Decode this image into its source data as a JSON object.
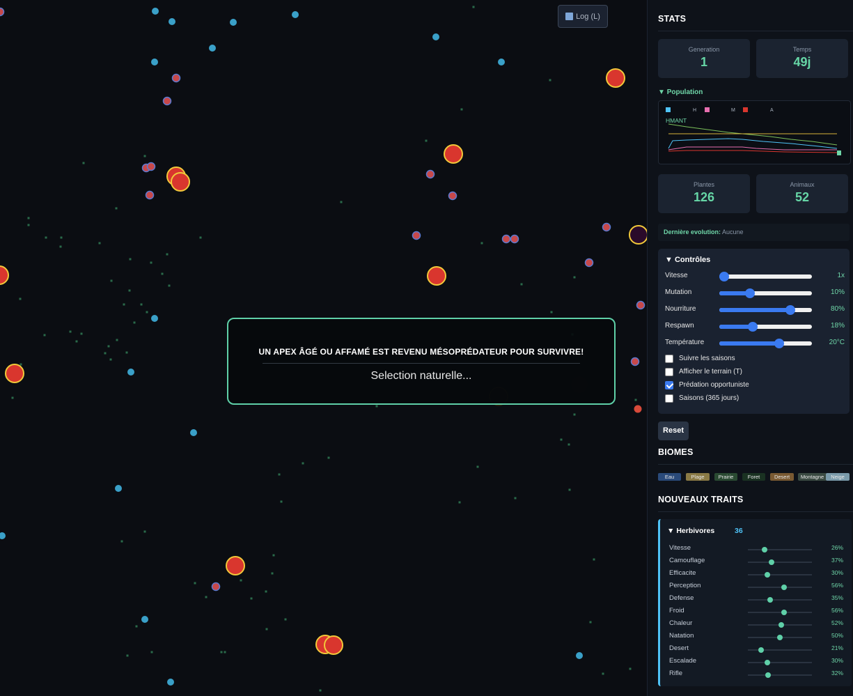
{
  "log_button": {
    "label": "Log (L)",
    "icon": "bar-chart-icon"
  },
  "notification": {
    "message": "UN APEX ÂGÉ OU AFFAMÉ EST REVENU MÉSOPRÉDATEUR POUR SURVIVRE!",
    "subtitle": "Selection naturelle..."
  },
  "stats": {
    "title": "STATS",
    "generation_label": "Generation",
    "generation": "1",
    "time_label": "Temps",
    "time": "49j",
    "population_title": "Population",
    "legend": [
      "H",
      "M",
      "A"
    ],
    "chart_letters": "HMANT",
    "plants_label": "Plantes",
    "plants": "126",
    "animals_label": "Animaux",
    "animals": "52",
    "evolution_label": "Dernière evolution:",
    "evolution_value": "Aucune"
  },
  "colors": {
    "herbivore": "#4fc3f7",
    "mesopredator": "#e86fb0",
    "apex": "#d9362e",
    "accent": "#66d6a6",
    "slider": "#3a7af0"
  },
  "controls": {
    "title": "Contrôles",
    "sliders": [
      {
        "name": "Vitesse",
        "value": "1x",
        "fraction": 0.05
      },
      {
        "name": "Mutation",
        "value": "10%",
        "fraction": 0.33
      },
      {
        "name": "Nourriture",
        "value": "80%",
        "fraction": 0.77
      },
      {
        "name": "Respawn",
        "value": "18%",
        "fraction": 0.36
      },
      {
        "name": "Température",
        "value": "20°C",
        "fraction": 0.65
      }
    ],
    "checkboxes": [
      {
        "label": "Suivre les saisons",
        "checked": false
      },
      {
        "label": "Afficher le terrain (T)",
        "checked": false
      },
      {
        "label": "Prédation opportuniste",
        "checked": true
      },
      {
        "label": "Saisons (365 jours)",
        "checked": false
      }
    ],
    "reset_label": "Reset"
  },
  "biomes": {
    "title": "BIOMES",
    "items": [
      {
        "name": "Eau",
        "color": "#2a4a7a"
      },
      {
        "name": "Plage",
        "color": "#8a7a45"
      },
      {
        "name": "Prairie",
        "color": "#2a4a32"
      },
      {
        "name": "Foret",
        "color": "#1a3222"
      },
      {
        "name": "Desert",
        "color": "#7a5a32"
      },
      {
        "name": "Montagne",
        "color": "#3a4a42"
      },
      {
        "name": "Neige",
        "color": "#7a9aaa"
      }
    ]
  },
  "traits": {
    "title": "NOUVEAUX TRAITS",
    "group_name": "Herbivores",
    "group_count": "36",
    "items": [
      {
        "name": "Vitesse",
        "value": "26%",
        "fraction": 0.26
      },
      {
        "name": "Camouflage",
        "value": "37%",
        "fraction": 0.37
      },
      {
        "name": "Efficacite",
        "value": "30%",
        "fraction": 0.3
      },
      {
        "name": "Perception",
        "value": "56%",
        "fraction": 0.56
      },
      {
        "name": "Defense",
        "value": "35%",
        "fraction": 0.35
      },
      {
        "name": "Froid",
        "value": "56%",
        "fraction": 0.56
      },
      {
        "name": "Chaleur",
        "value": "52%",
        "fraction": 0.52
      },
      {
        "name": "Natation",
        "value": "50%",
        "fraction": 0.5
      },
      {
        "name": "Desert",
        "value": "21%",
        "fraction": 0.21
      },
      {
        "name": "Escalade",
        "value": "30%",
        "fraction": 0.3
      },
      {
        "name": "Rifle",
        "value": "32%",
        "fraction": 0.32
      }
    ]
  }
}
